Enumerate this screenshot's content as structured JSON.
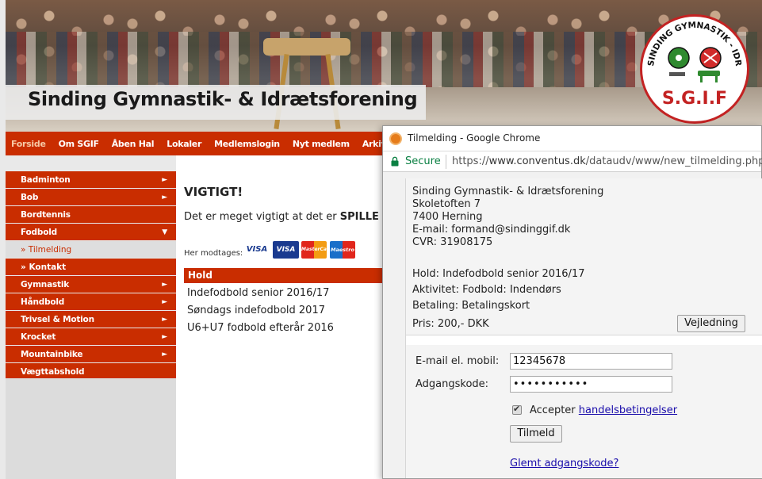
{
  "site": {
    "title": "Sinding Gymnastik- & Idrætsforening",
    "logo_ring_text": "SINDING GYMNASTIK - IDRÆTSFORENING",
    "logo_initials": "S.G.I.F"
  },
  "topnav": [
    "Forside",
    "Om SGIF",
    "Åben Hal",
    "Lokaler",
    "Medlemslogin",
    "Nyt medlem",
    "Arkiv"
  ],
  "sidebar": {
    "items": [
      {
        "label": "Badminton",
        "arrow": "►"
      },
      {
        "label": "Bob",
        "arrow": "►"
      },
      {
        "label": "Bordtennis",
        "arrow": ""
      },
      {
        "label": "Fodbold",
        "arrow": "▼"
      },
      {
        "label": "» Tilmelding",
        "sub": true,
        "active": true
      },
      {
        "label": "» Kontakt",
        "sub": true
      },
      {
        "label": "Gymnastik",
        "arrow": "►"
      },
      {
        "label": "Håndbold",
        "arrow": "►"
      },
      {
        "label": "Trivsel & Motion",
        "arrow": "►"
      },
      {
        "label": "Krocket",
        "arrow": "►"
      },
      {
        "label": "Mountainbike",
        "arrow": "►"
      },
      {
        "label": "Vægttabshold",
        "arrow": ""
      }
    ]
  },
  "main": {
    "heading": "VIGTIGT!",
    "text_prefix": "Det er meget vigtigt at det er ",
    "text_bold": "SPILLE",
    "accepts_label": "Her modtages:",
    "cards": [
      "VISA",
      "VISA",
      "MasterCard",
      "Maestro"
    ],
    "hold_header": "Hold",
    "hold_rows": [
      "Indefodbold senior 2016/17",
      "Søndags indefodbold 2017",
      "U6+U7 fodbold efterår 2016"
    ]
  },
  "popup": {
    "title": "Tilmelding - Google Chrome",
    "secure_label": "Secure",
    "url_scheme": "https://",
    "url_host": "www.conventus.dk",
    "url_path": "/dataudv/www/new_tilmelding.php?fo",
    "info": {
      "org": "Sinding Gymnastik- & Idrætsforening",
      "street": "Skoletoften 7",
      "city": "7400 Herning",
      "email": "E-mail: formand@sindinggif.dk",
      "cvr": "CVR: 31908175",
      "hold": "Hold: Indefodbold senior 2016/17",
      "aktivitet": "Aktivitet: Fodbold: Indendørs",
      "betaling": "Betaling: Betalingskort",
      "pris": "Pris: 200,- DKK"
    },
    "vejledning_button": "Vejledning",
    "login": {
      "email_label": "E-mail el. mobil:",
      "email_value": "12345678",
      "password_label": "Adgangskode:",
      "password_value": "•••••••••••",
      "accept_text": "Accepter ",
      "accept_link": "handelsbetingelser",
      "accept_checked": true,
      "submit_button": "Tilmeld",
      "forgot_link": "Glemt adgangskode?"
    }
  },
  "colors": {
    "brand_red": "#c92d00",
    "link_blue": "#1a0dab",
    "secure_green": "#0b8043"
  }
}
